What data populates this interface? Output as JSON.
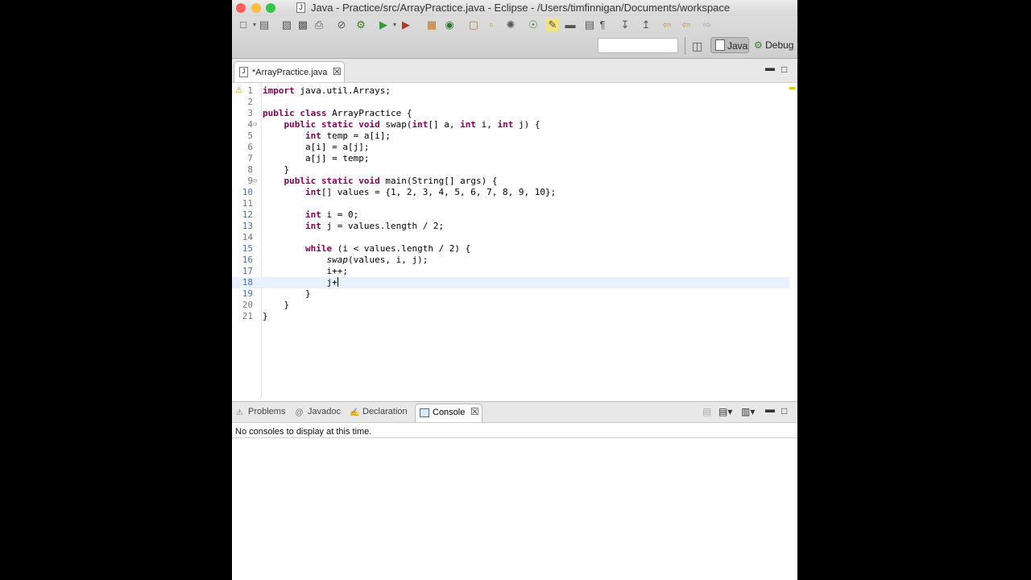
{
  "window": {
    "title": "Java - Practice/src/ArrayPractice.java - Eclipse - /Users/timfinnigan/Documents/workspace",
    "title_icon": "J",
    "traffic_lights": [
      "#fc605b",
      "#fdbc40",
      "#34c84a"
    ]
  },
  "toolbar": {
    "icons": [
      "new-icon",
      "open-type-icon",
      "save-icon",
      "save-all-icon",
      "print-icon",
      "skip-breakpoints-icon",
      "debug-icon",
      "run-icon",
      "run-config-icon",
      "new-java-project-icon",
      "new-package-icon",
      "new-class-icon",
      "open-type-icon",
      "open-task-icon",
      "search-icon",
      "annotation-icon",
      "toggle-mark-icon",
      "block-selection-icon",
      "show-whitespace-icon",
      "next-annotation-icon",
      "prev-annotation-icon",
      "back-icon",
      "forward-icon"
    ],
    "perspectives": {
      "java_label": "Java",
      "debug_label": "Debug"
    }
  },
  "editor": {
    "tab_label": "*ArrayPractice.java",
    "tab_icon": "J",
    "lines": [
      {
        "n": "1",
        "text": "import java.util.Arrays;"
      },
      {
        "n": "2",
        "text": ""
      },
      {
        "n": "3",
        "text": "public class ArrayPractice {"
      },
      {
        "n": "4",
        "text": "    public static void swap(int[] a, int i, int j) {"
      },
      {
        "n": "5",
        "text": "        int temp = a[i];"
      },
      {
        "n": "6",
        "text": "        a[i] = a[j];"
      },
      {
        "n": "7",
        "text": "        a[j] = temp;"
      },
      {
        "n": "8",
        "text": "    }"
      },
      {
        "n": "9",
        "text": "    public static void main(String[] args) {"
      },
      {
        "n": "10",
        "text": "        int[] values = {1, 2, 3, 4, 5, 6, 7, 8, 9, 10};"
      },
      {
        "n": "11",
        "text": ""
      },
      {
        "n": "12",
        "text": "        int i = 0;"
      },
      {
        "n": "13",
        "text": "        int j = values.length / 2;"
      },
      {
        "n": "14",
        "text": ""
      },
      {
        "n": "15",
        "text": "        while (i < values.length / 2) {"
      },
      {
        "n": "16",
        "text": "            swap(values, i, j);"
      },
      {
        "n": "17",
        "text": "            i++;"
      },
      {
        "n": "18",
        "text": "            j+"
      },
      {
        "n": "19",
        "text": "        }"
      },
      {
        "n": "20",
        "text": "    }"
      },
      {
        "n": "21",
        "text": "}"
      }
    ],
    "current_line": "18"
  },
  "panel": {
    "tabs": [
      {
        "label": "Problems",
        "icon": "problems-icon"
      },
      {
        "label": "Javadoc",
        "icon": "javadoc-icon"
      },
      {
        "label": "Declaration",
        "icon": "declaration-icon"
      }
    ],
    "active_tab": "Console",
    "message": "No consoles to display at this time."
  }
}
